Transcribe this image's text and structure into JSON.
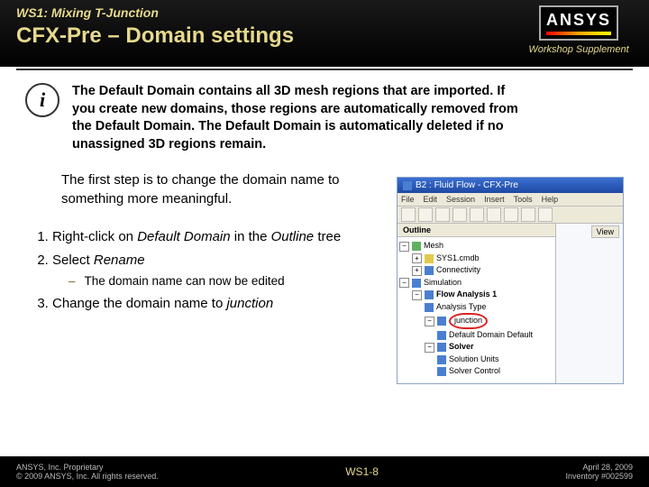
{
  "header": {
    "supertitle": "WS1: Mixing T-Junction",
    "title": "CFX-Pre – Domain settings",
    "logo_text": "ANSYS",
    "workshop_label": "Workshop Supplement"
  },
  "content": {
    "info_glyph": "i",
    "info_text": "The Default Domain contains all 3D mesh regions that are imported. If you create new domains, those regions are automatically removed from the Default Domain. The Default Domain is automatically deleted if no unassigned 3D regions remain.",
    "lead": "The first step is to change the domain name to something more meaningful.",
    "steps": [
      {
        "pre": "Right-click on ",
        "em": "Default Domain",
        "post": " in the ",
        "em2": "Outline",
        "post2": " tree"
      },
      {
        "pre": "Select ",
        "em": "Rename",
        "sub": "The domain name can now be edited"
      },
      {
        "pre": "Change the domain name to ",
        "em": "junction"
      }
    ]
  },
  "screenshot": {
    "window_title": "B2 : Fluid Flow - CFX-Pre",
    "menus": [
      "File",
      "Edit",
      "Session",
      "Insert",
      "Tools",
      "Help"
    ],
    "outline_tab": "Outline",
    "view_tab": "View",
    "tree": {
      "mesh": "Mesh",
      "sys1": "SYS1.cmdb",
      "connectivity": "Connectivity",
      "simulation": "Simulation",
      "flow": "Flow Analysis 1",
      "analysis_type": "Analysis Type",
      "junction": "junction",
      "domain_default": "Default Domain Default",
      "solver": "Solver",
      "solution_units": "Solution Units",
      "solver_control": "Solver Control"
    }
  },
  "footer": {
    "left1": "ANSYS, Inc. Proprietary",
    "left2": "© 2009 ANSYS, Inc.  All rights reserved.",
    "center": "WS1-8",
    "right1": "April 28, 2009",
    "right2": "Inventory #002599"
  }
}
